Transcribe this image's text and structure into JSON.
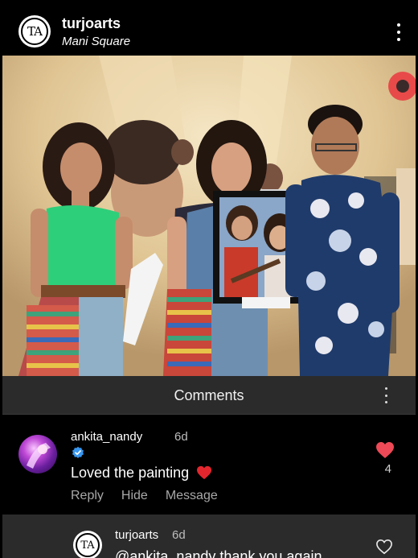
{
  "post_header": {
    "username": "turjoarts",
    "location": "Mani Square",
    "avatar_icon": "turjoarts-logo-icon",
    "menu_icon": "more-vertical-icon"
  },
  "photo": {
    "description_icon": "event-photo-image",
    "colors": {
      "backdrop": "#e3c995",
      "green_top": "#2ecf7a",
      "shirt": "#1f3b6b",
      "frame": "#111111"
    }
  },
  "comments_panel": {
    "title": "Comments",
    "menu_icon": "more-vertical-icon"
  },
  "comment": {
    "username": "ankita_nandy",
    "time": "6d",
    "verified_icon": "verified-badge-icon",
    "text": "Loved the painting",
    "emoji": "❤️",
    "actions": [
      "Reply",
      "Hide",
      "Message"
    ],
    "like_icon": "heart-filled-icon",
    "like_count": "4",
    "like_color": "#ed4956"
  },
  "reply": {
    "username": "turjoarts",
    "time": "6d",
    "text": "@ankita_nandy thank you again",
    "like_icon": "heart-outline-icon"
  }
}
